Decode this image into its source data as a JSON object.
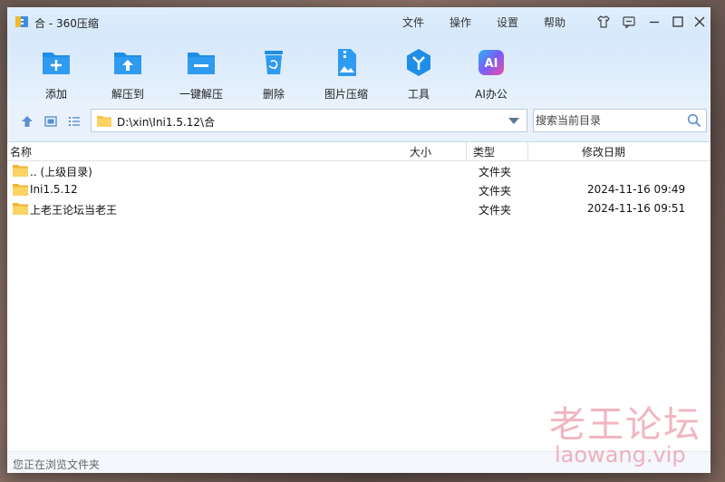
{
  "window": {
    "title": "合 - 360压缩"
  },
  "menu": {
    "file": "文件",
    "operation": "操作",
    "settings": "设置",
    "help": "帮助"
  },
  "toolbar": {
    "add": "添加",
    "extract_to": "解压到",
    "one_click_extract": "一键解压",
    "delete": "删除",
    "image_compress": "图片压缩",
    "tools": "工具",
    "ai_office": "AI办公",
    "ai_badge": "AI"
  },
  "address": {
    "path": "D:\\xin\\Ini1.5.12\\合"
  },
  "search": {
    "placeholder": "搜索当前目录"
  },
  "columns": {
    "name": "名称",
    "size": "大小",
    "type": "类型",
    "modified": "修改日期"
  },
  "files": [
    {
      "name": ".. (上级目录)",
      "size": "",
      "type": "文件夹",
      "modified": ""
    },
    {
      "name": "Ini1.5.12",
      "size": "",
      "type": "文件夹",
      "modified": "2024-11-16 09:49"
    },
    {
      "name": "上老王论坛当老王",
      "size": "",
      "type": "文件夹",
      "modified": "2024-11-16 09:51"
    }
  ],
  "status": {
    "text": "您正在浏览文件夹"
  },
  "watermark": {
    "cn": "老王论坛",
    "en": "laowang.vip"
  },
  "colors": {
    "accent": "#1e8ee8",
    "folder": "#f6c344",
    "titlebar": "#dfeefe"
  }
}
